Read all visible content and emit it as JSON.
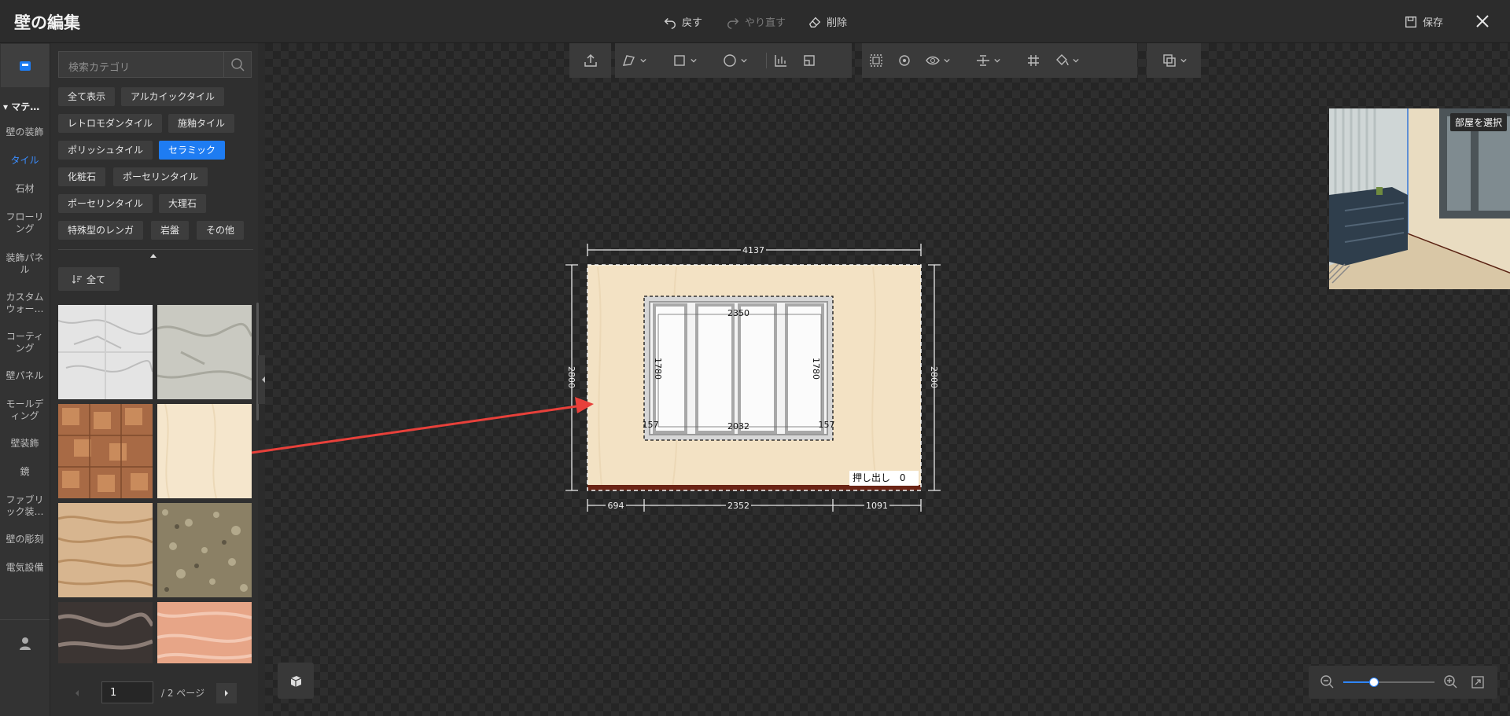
{
  "header": {
    "title": "壁の編集",
    "undo": "戻す",
    "redo": "やり直す",
    "delete": "削除",
    "save": "保存"
  },
  "rail": {
    "section": "▾ マテ…",
    "items": [
      {
        "label": "壁の装飾"
      },
      {
        "label": "タイル",
        "active": true
      },
      {
        "label": "石材"
      },
      {
        "label": "フローリング"
      },
      {
        "label": "装飾パネル"
      },
      {
        "label": "カスタムウォー…"
      },
      {
        "label": "コーティング"
      },
      {
        "label": "壁パネル"
      },
      {
        "label": "モールディング"
      },
      {
        "label": "壁装飾"
      },
      {
        "label": "鏡"
      },
      {
        "label": "ファブリック装…"
      },
      {
        "label": "壁の彫刻"
      },
      {
        "label": "電気設備"
      }
    ]
  },
  "panel": {
    "search_placeholder": "検索カテゴリ",
    "tags": [
      "全て表示",
      "アルカイックタイル",
      "レトロモダンタイル",
      "施釉タイル",
      "ポリッシュタイル",
      "セラミック",
      "化粧石",
      "ポーセリンタイル",
      "ポーセリンタイル",
      "大理石",
      "特殊型のレンガ",
      "岩盤",
      "その他"
    ],
    "active_tag": "セラミック",
    "sort_label": "全て",
    "pager": {
      "current": "1",
      "total": "/ 2 ページ"
    }
  },
  "canvas": {
    "dimensions": {
      "top": "4137",
      "left": "2800",
      "right": "2800",
      "window_top": "2350",
      "window_left": "1780",
      "window_right": "1780",
      "window_bottom": "2032",
      "window_corner_left": "157",
      "window_corner_right": "157",
      "bottom_left": "694",
      "bottom_mid": "2352",
      "bottom_right": "1091"
    },
    "extrude_label": "押し出し",
    "extrude_value": "0",
    "preview_label": "部屋を選択"
  },
  "colors": {
    "accent": "#1e7cf2",
    "wall": "#f3e2c4",
    "arrow": "#e8403a"
  }
}
